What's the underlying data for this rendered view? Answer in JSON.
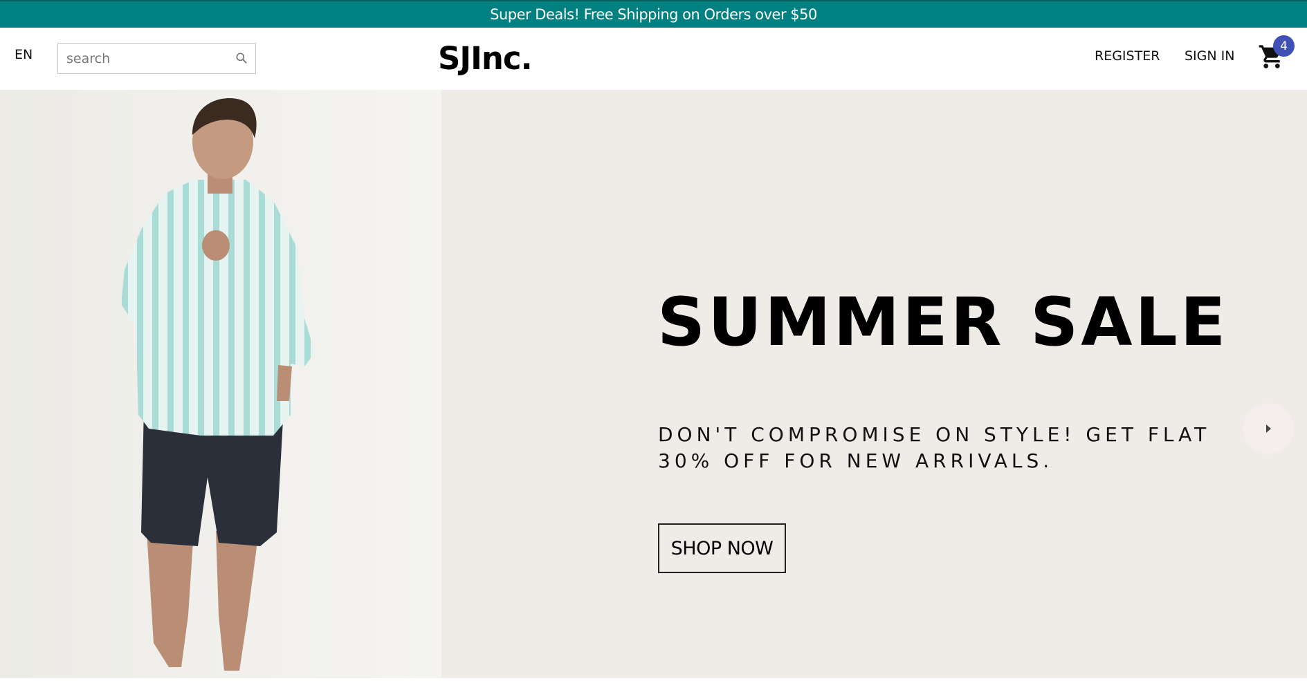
{
  "announcement": {
    "text": "Super Deals! Free Shipping on Orders over $50"
  },
  "header": {
    "language": "EN",
    "search": {
      "placeholder": "search",
      "value": ""
    },
    "logo": "SJInc.",
    "register_label": "REGISTER",
    "signin_label": "SIGN IN",
    "cart_count": "4"
  },
  "hero": {
    "title": "SUMMER SALE",
    "description": "DON'T COMPROMISE ON STYLE! GET FLAT 30% OFF FOR NEW ARRIVALS.",
    "cta_label": "SHOP NOW"
  },
  "colors": {
    "announcement_bg": "#008080",
    "hero_bg": "#efebe7",
    "badge_bg": "#3f51b5"
  },
  "icons": [
    "search-icon",
    "cart-icon",
    "chevron-right-icon"
  ]
}
